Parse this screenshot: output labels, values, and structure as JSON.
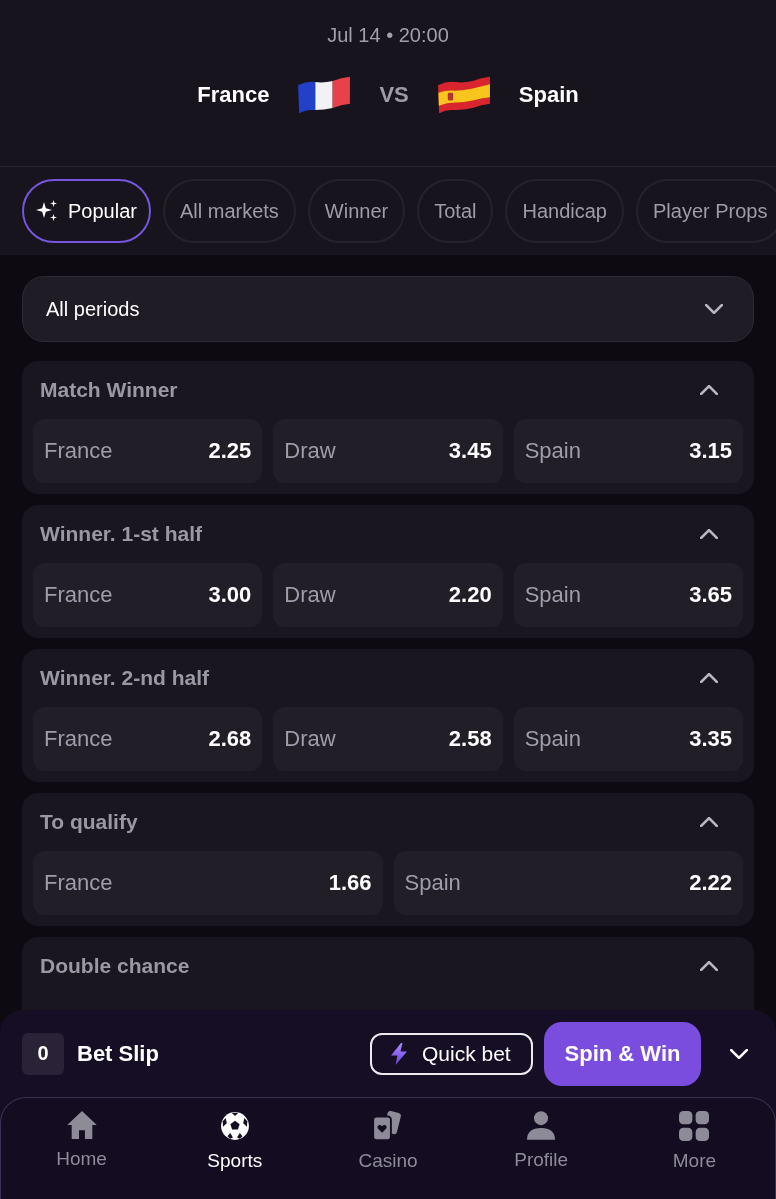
{
  "match": {
    "date": "Jul 14 • 20:00",
    "home_team": "France",
    "versus": "VS",
    "away_team": "Spain"
  },
  "tabs": [
    {
      "label": "Popular",
      "kind": "featured",
      "selected": true
    },
    {
      "label": "All markets",
      "kind": "plain",
      "selected": false
    },
    {
      "label": "Winner",
      "kind": "plain",
      "selected": false
    },
    {
      "label": "Total",
      "kind": "plain",
      "selected": false
    },
    {
      "label": "Handicap",
      "kind": "plain",
      "selected": false
    },
    {
      "label": "Player Props",
      "kind": "plain",
      "selected": false
    }
  ],
  "period_filter": {
    "value": "All periods"
  },
  "markets": [
    {
      "title": "Match Winner",
      "expanded": true,
      "outcomes": [
        {
          "label": "France",
          "odds": "2.25"
        },
        {
          "label": "Draw",
          "odds": "3.45"
        },
        {
          "label": "Spain",
          "odds": "3.15"
        }
      ]
    },
    {
      "title": "Winner. 1-st half",
      "expanded": true,
      "outcomes": [
        {
          "label": "France",
          "odds": "3.00"
        },
        {
          "label": "Draw",
          "odds": "2.20"
        },
        {
          "label": "Spain",
          "odds": "3.65"
        }
      ]
    },
    {
      "title": "Winner. 2-nd half",
      "expanded": true,
      "outcomes": [
        {
          "label": "France",
          "odds": "2.68"
        },
        {
          "label": "Draw",
          "odds": "2.58"
        },
        {
          "label": "Spain",
          "odds": "3.35"
        }
      ]
    },
    {
      "title": "To qualify",
      "expanded": true,
      "outcomes": [
        {
          "label": "France",
          "odds": "1.66"
        },
        {
          "label": "Spain",
          "odds": "2.22"
        }
      ]
    },
    {
      "title": "Double chance",
      "expanded": true
    }
  ],
  "bet_slip": {
    "count": "0",
    "title": "Bet Slip",
    "quick_bet": "Quick bet",
    "spin_button": "Spin & Win"
  },
  "nav": [
    {
      "label": "Home",
      "selected": false
    },
    {
      "label": "Sports",
      "selected": true
    },
    {
      "label": "Casino",
      "selected": false
    },
    {
      "label": "Profile",
      "selected": false
    },
    {
      "label": "More",
      "selected": false
    }
  ]
}
